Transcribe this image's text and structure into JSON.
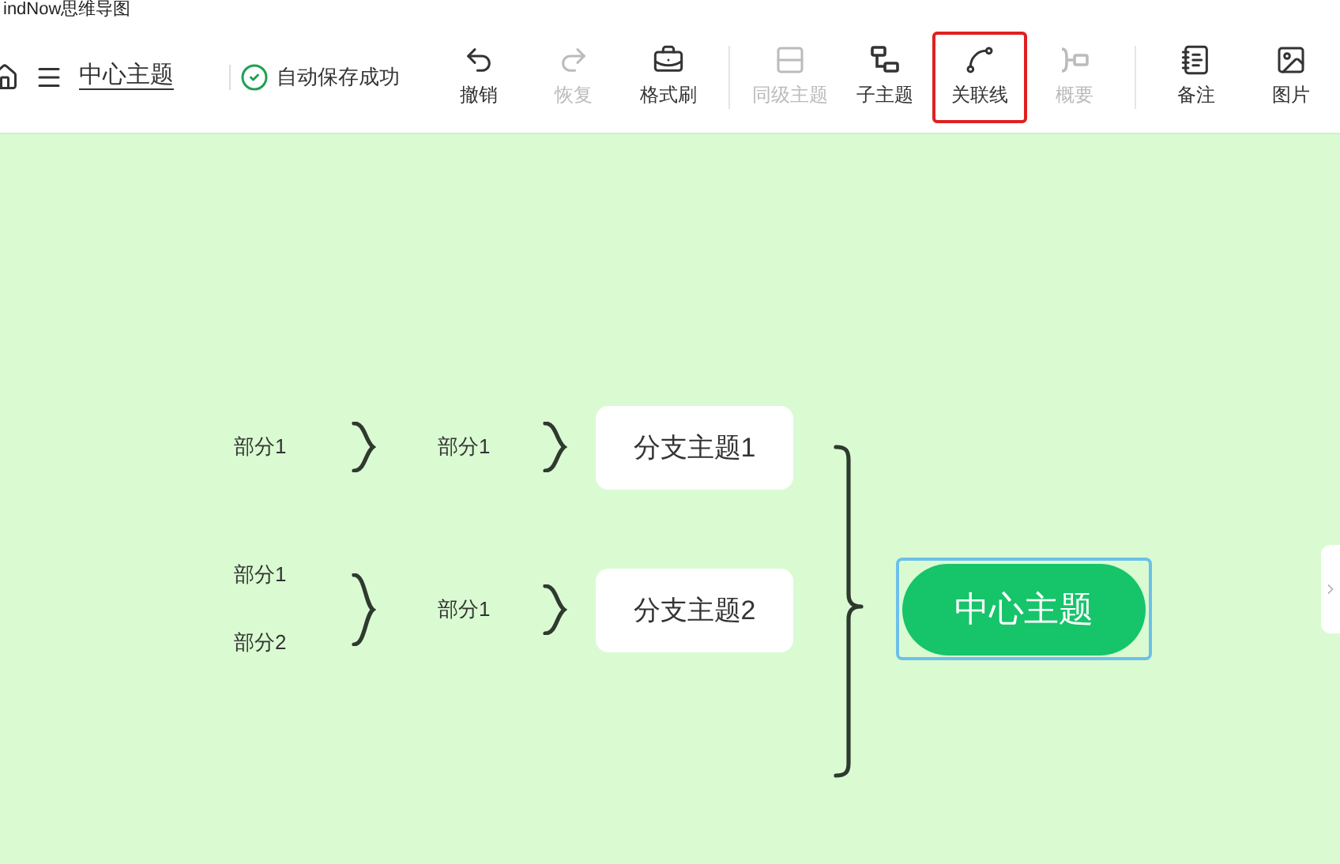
{
  "window": {
    "title": "indNow思维导图"
  },
  "header": {
    "document_title": "中心主题",
    "save_status": "自动保存成功"
  },
  "tools": [
    {
      "kind": "undo",
      "label": "撤销",
      "disabled": false,
      "highlighted": false
    },
    {
      "kind": "redo",
      "label": "恢复",
      "disabled": true,
      "highlighted": false
    },
    {
      "kind": "format",
      "label": "格式刷",
      "disabled": false,
      "highlighted": false
    },
    {
      "kind": "divider"
    },
    {
      "kind": "sibling",
      "label": "同级主题",
      "disabled": true,
      "highlighted": false
    },
    {
      "kind": "child",
      "label": "子主题",
      "disabled": false,
      "highlighted": false
    },
    {
      "kind": "relation",
      "label": "关联线",
      "disabled": false,
      "highlighted": true
    },
    {
      "kind": "summary",
      "label": "概要",
      "disabled": true,
      "highlighted": false
    },
    {
      "kind": "divider"
    },
    {
      "kind": "note",
      "label": "备注",
      "disabled": false,
      "highlighted": false
    },
    {
      "kind": "image",
      "label": "图片",
      "disabled": false,
      "highlighted": false
    }
  ],
  "mindmap": {
    "center": {
      "label": "中心主题",
      "selected": true
    },
    "branches": [
      {
        "label": "分支主题1",
        "children": [
          {
            "label": "部分1",
            "children": [
              {
                "label": "部分1"
              }
            ]
          }
        ]
      },
      {
        "label": "分支主题2",
        "children": [
          {
            "label": "部分1",
            "children": [
              {
                "label": "部分1"
              },
              {
                "label": "部分2"
              }
            ]
          }
        ]
      }
    ]
  }
}
